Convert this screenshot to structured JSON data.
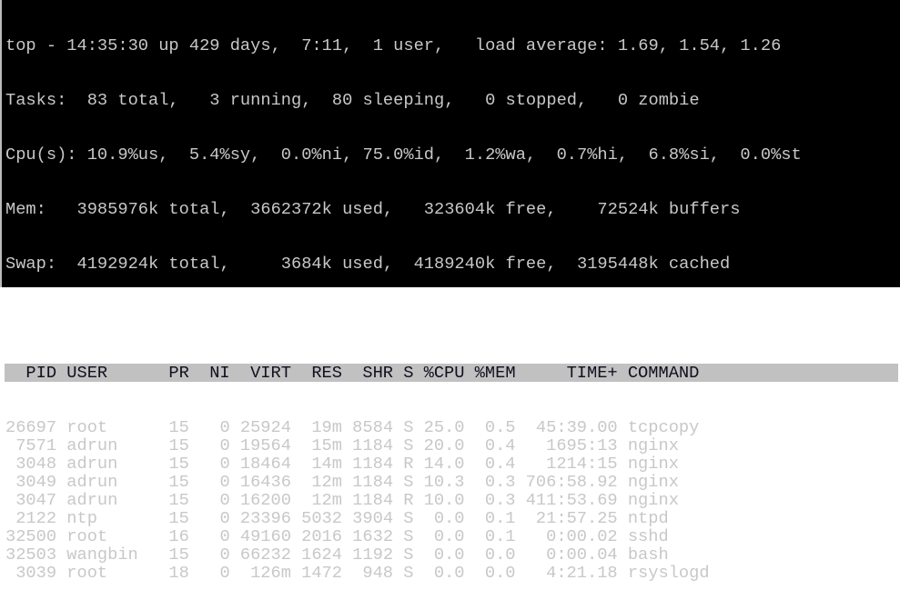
{
  "summary": {
    "top_line": "top - 14:35:30 up 429 days,  7:11,  1 user,   load average: 1.69, 1.54, 1.26",
    "tasks_line": "Tasks:  83 total,   3 running,  80 sleeping,   0 stopped,   0 zombie",
    "cpu_line": "Cpu(s): 10.9%us,  5.4%sy,  0.0%ni, 75.0%id,  1.2%wa,  0.7%hi,  6.8%si,  0.0%st",
    "mem_line": "Mem:   3985976k total,  3662372k used,   323604k free,    72524k buffers",
    "swap_line": "Swap:  4192924k total,     3684k used,  4189240k free,  3195448k cached"
  },
  "columns": [
    "PID",
    "USER",
    "PR",
    "NI",
    "VIRT",
    "RES",
    "SHR",
    "S",
    "%CPU",
    "%MEM",
    "TIME+",
    "COMMAND"
  ],
  "processes": [
    [
      "26697",
      "root",
      "15",
      "0",
      "25924",
      "19m",
      "8584",
      "S",
      "25.0",
      "0.5",
      "45:39.00",
      "tcpcopy"
    ],
    [
      "7571",
      "adrun",
      "15",
      "0",
      "19564",
      "15m",
      "1184",
      "S",
      "20.0",
      "0.4",
      "1695:13",
      "nginx"
    ],
    [
      "3048",
      "adrun",
      "15",
      "0",
      "18464",
      "14m",
      "1184",
      "R",
      "14.0",
      "0.4",
      "1214:15",
      "nginx"
    ],
    [
      "3049",
      "adrun",
      "15",
      "0",
      "16436",
      "12m",
      "1184",
      "S",
      "10.3",
      "0.3",
      "706:58.92",
      "nginx"
    ],
    [
      "3047",
      "adrun",
      "15",
      "0",
      "16200",
      "12m",
      "1184",
      "R",
      "10.0",
      "0.3",
      "411:53.69",
      "nginx"
    ],
    [
      "2122",
      "ntp",
      "15",
      "0",
      "23396",
      "5032",
      "3904",
      "S",
      "0.0",
      "0.1",
      "21:57.25",
      "ntpd"
    ],
    [
      "32500",
      "root",
      "16",
      "0",
      "49160",
      "2016",
      "1632",
      "S",
      "0.0",
      "0.1",
      "0:00.02",
      "sshd"
    ],
    [
      "32503",
      "wangbin",
      "15",
      "0",
      "66232",
      "1624",
      "1192",
      "S",
      "0.0",
      "0.0",
      "0:00.04",
      "bash"
    ],
    [
      "3039",
      "root",
      "18",
      "0",
      "126m",
      "1472",
      "948",
      "S",
      "0.0",
      "0.0",
      "4:21.18",
      "rsyslogd"
    ]
  ]
}
